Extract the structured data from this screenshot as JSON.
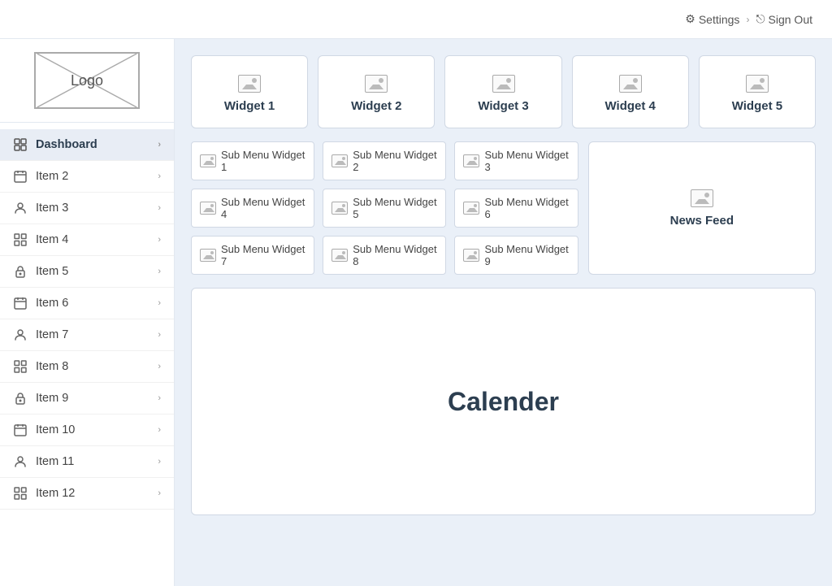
{
  "topbar": {
    "settings_label": "Settings",
    "signout_label": "Sign Out",
    "separator": "›"
  },
  "logo": {
    "text": "Logo"
  },
  "sidebar": {
    "items": [
      {
        "id": "dashboard",
        "label": "Dashboard",
        "icon": "dashboard-icon",
        "active": true
      },
      {
        "id": "item2",
        "label": "Item 2",
        "icon": "calendar-icon",
        "active": false
      },
      {
        "id": "item3",
        "label": "Item 3",
        "icon": "person-icon",
        "active": false
      },
      {
        "id": "item4",
        "label": "Item 4",
        "icon": "grid-icon",
        "active": false
      },
      {
        "id": "item5",
        "label": "Item 5",
        "icon": "lock-icon",
        "active": false
      },
      {
        "id": "item6",
        "label": "Item 6",
        "icon": "calendar-icon",
        "active": false
      },
      {
        "id": "item7",
        "label": "Item 7",
        "icon": "person-icon",
        "active": false
      },
      {
        "id": "item8",
        "label": "Item 8",
        "icon": "grid-icon",
        "active": false
      },
      {
        "id": "item9",
        "label": "Item 9",
        "icon": "lock-icon",
        "active": false
      },
      {
        "id": "item10",
        "label": "Item 10",
        "icon": "calendar-icon",
        "active": false
      },
      {
        "id": "item11",
        "label": "Item 11",
        "icon": "person-icon",
        "active": false
      },
      {
        "id": "item12",
        "label": "Item 12",
        "icon": "grid-icon",
        "active": false
      }
    ]
  },
  "widgets": [
    {
      "id": "w1",
      "label": "Widget 1"
    },
    {
      "id": "w2",
      "label": "Widget 2"
    },
    {
      "id": "w3",
      "label": "Widget 3"
    },
    {
      "id": "w4",
      "label": "Widget 4"
    },
    {
      "id": "w5",
      "label": "Widget 5"
    }
  ],
  "sub_widgets": [
    {
      "id": "sw1",
      "label": "Sub Menu Widget 1"
    },
    {
      "id": "sw2",
      "label": "Sub Menu Widget 2"
    },
    {
      "id": "sw3",
      "label": "Sub Menu Widget 3"
    },
    {
      "id": "sw4",
      "label": "Sub Menu Widget 4"
    },
    {
      "id": "sw5",
      "label": "Sub Menu Widget 5"
    },
    {
      "id": "sw6",
      "label": "Sub Menu Widget 6"
    },
    {
      "id": "sw7",
      "label": "Sub Menu Widget 7"
    },
    {
      "id": "sw8",
      "label": "Sub Menu Widget 8"
    },
    {
      "id": "sw9",
      "label": "Sub Menu Widget 9"
    }
  ],
  "news_feed": {
    "label": "News Feed"
  },
  "calendar": {
    "label": "Calender"
  }
}
